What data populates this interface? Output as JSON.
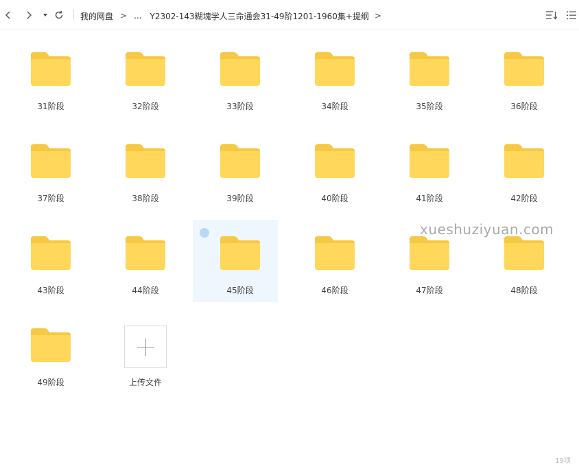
{
  "toolbar": {
    "back_icon": "chevron-left-icon",
    "forward_icon": "chevron-right-icon",
    "history_icon": "caret-down-icon",
    "refresh_icon": "refresh-icon",
    "sort_icon": "sort-icon",
    "view_icon": "list-view-icon"
  },
  "breadcrumb": {
    "root": "我的网盘",
    "gt": ">",
    "ellipsis": "...",
    "current": "Y2302-143糊塊学人三命通会31-49阶1201-1960集+提纲",
    "trail": ">"
  },
  "colors": {
    "folder_body": "#ffd75a",
    "folder_tab": "#f7c843",
    "selected_bg": "#eef6fe"
  },
  "items": [
    {
      "name": "31阶段",
      "type": "folder"
    },
    {
      "name": "32阶段",
      "type": "folder"
    },
    {
      "name": "33阶段",
      "type": "folder"
    },
    {
      "name": "34阶段",
      "type": "folder"
    },
    {
      "name": "35阶段",
      "type": "folder"
    },
    {
      "name": "36阶段",
      "type": "folder"
    },
    {
      "name": "37阶段",
      "type": "folder"
    },
    {
      "name": "38阶段",
      "type": "folder"
    },
    {
      "name": "39阶段",
      "type": "folder"
    },
    {
      "name": "40阶段",
      "type": "folder"
    },
    {
      "name": "41阶段",
      "type": "folder"
    },
    {
      "name": "42阶段",
      "type": "folder"
    },
    {
      "name": "43阶段",
      "type": "folder"
    },
    {
      "name": "44阶段",
      "type": "folder"
    },
    {
      "name": "45阶段",
      "type": "folder",
      "selected": true
    },
    {
      "name": "46阶段",
      "type": "folder"
    },
    {
      "name": "47阶段",
      "type": "folder"
    },
    {
      "name": "48阶段",
      "type": "folder"
    },
    {
      "name": "49阶段",
      "type": "folder"
    }
  ],
  "upload": {
    "label": "上传文件",
    "icon": "plus-icon"
  },
  "watermark": "xueshuziyuan.com",
  "item_count": "19项"
}
